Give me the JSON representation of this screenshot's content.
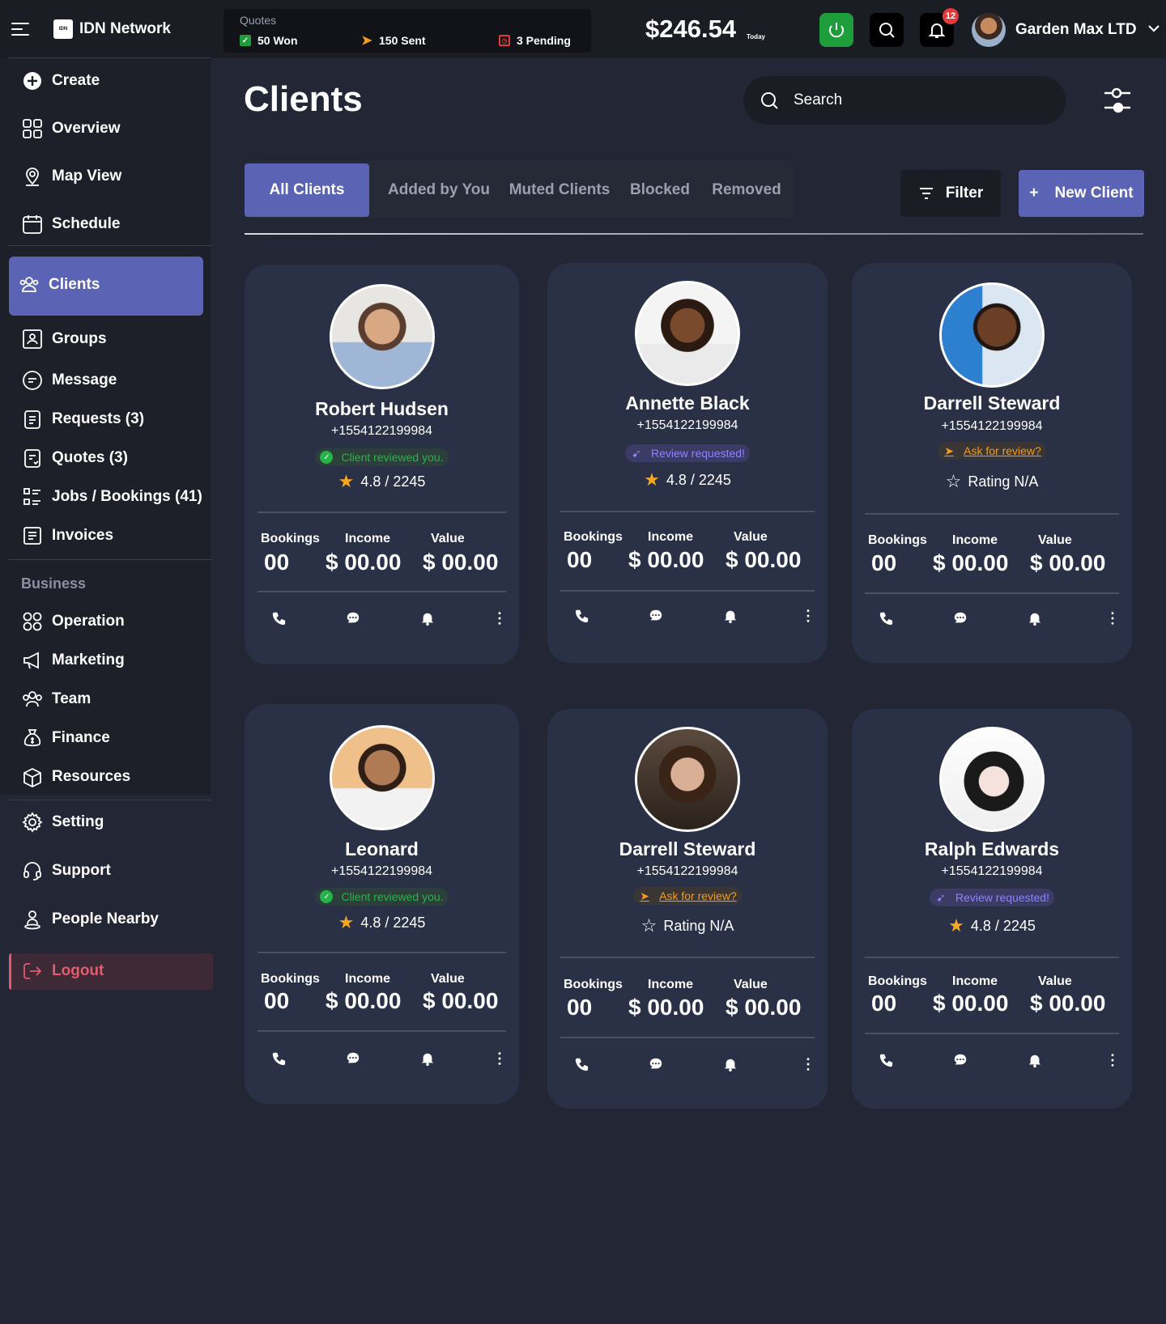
{
  "app": {
    "brand": "IDN Network",
    "logo_text": "IDN"
  },
  "sidebar": {
    "items": [
      {
        "label": "Create"
      },
      {
        "label": "Overview"
      },
      {
        "label": "Map View"
      },
      {
        "label": "Schedule"
      },
      {
        "label": "Clients"
      },
      {
        "label": "Groups"
      },
      {
        "label": "Message"
      },
      {
        "label": "Requests (3)"
      },
      {
        "label": "Quotes (3)"
      },
      {
        "label": "Jobs / Bookings (41)"
      },
      {
        "label": "Invoices"
      }
    ],
    "business_heading": "Business",
    "business_items": [
      {
        "label": "Operation"
      },
      {
        "label": "Marketing"
      },
      {
        "label": "Team"
      },
      {
        "label": "Finance"
      },
      {
        "label": "Resources"
      }
    ],
    "bottom_items": [
      {
        "label": "Setting"
      },
      {
        "label": "Support"
      },
      {
        "label": "People Nearby"
      }
    ],
    "logout": "Logout"
  },
  "topbar": {
    "quotes_title": "Quotes",
    "won": "50 Won",
    "sent": "150 Sent",
    "pending": "3 Pending",
    "amount": "$246.54",
    "amount_period": "Today",
    "notifications_count": "12",
    "user_name": "Garden Max LTD"
  },
  "main": {
    "title": "Clients",
    "search_placeholder": "Search",
    "tabs": [
      {
        "label": "All Clients",
        "active": true
      },
      {
        "label": "Added by You"
      },
      {
        "label": "Muted Clients"
      },
      {
        "label": "Blocked"
      },
      {
        "label": "Removed"
      }
    ],
    "filter_label": "Filter",
    "new_client_label": "New Client"
  },
  "stat_labels": {
    "bookings": "Bookings",
    "income": "Income",
    "value": "Value"
  },
  "clients": [
    {
      "name": "Robert Hudsen",
      "phone": "+1554122199984",
      "badge": "Client reviewed you.",
      "badge_type": "green",
      "rating": "4.8 / 2245",
      "bookings": "00",
      "income": "$ 00.00",
      "value": "$ 00.00"
    },
    {
      "name": "Annette Black",
      "phone": "+1554122199984",
      "badge": "Review requested!",
      "badge_type": "purple",
      "rating": "4.8 / 2245",
      "bookings": "00",
      "income": "$ 00.00",
      "value": "$ 00.00"
    },
    {
      "name": "Darrell Steward",
      "phone": "+1554122199984",
      "badge": "Ask for review?",
      "badge_type": "orange",
      "rating": "Rating N/A",
      "bookings": "00",
      "income": "$ 00.00",
      "value": "$ 00.00"
    },
    {
      "name": "Leonard",
      "phone": "+1554122199984",
      "badge": "Client reviewed you.",
      "badge_type": "green",
      "rating": "4.8 / 2245",
      "bookings": "00",
      "income": "$ 00.00",
      "value": "$ 00.00"
    },
    {
      "name": "Darrell Steward",
      "phone": "+1554122199984",
      "badge": "Ask for review?",
      "badge_type": "orange",
      "rating": "Rating N/A",
      "bookings": "00",
      "income": "$ 00.00",
      "value": "$ 00.00"
    },
    {
      "name": "Ralph Edwards",
      "phone": "+1554122199984",
      "badge": "Review requested!",
      "badge_type": "purple",
      "rating": "4.8 / 2245",
      "bookings": "00",
      "income": "$ 00.00",
      "value": "$ 00.00"
    }
  ],
  "colors": {
    "accent": "#5b63b5",
    "card": "#2a3147",
    "bg": "#232634",
    "green": "#26b44a",
    "purple": "#8d83ff",
    "orange": "#f39c1e",
    "logout": "#e25b6f"
  }
}
